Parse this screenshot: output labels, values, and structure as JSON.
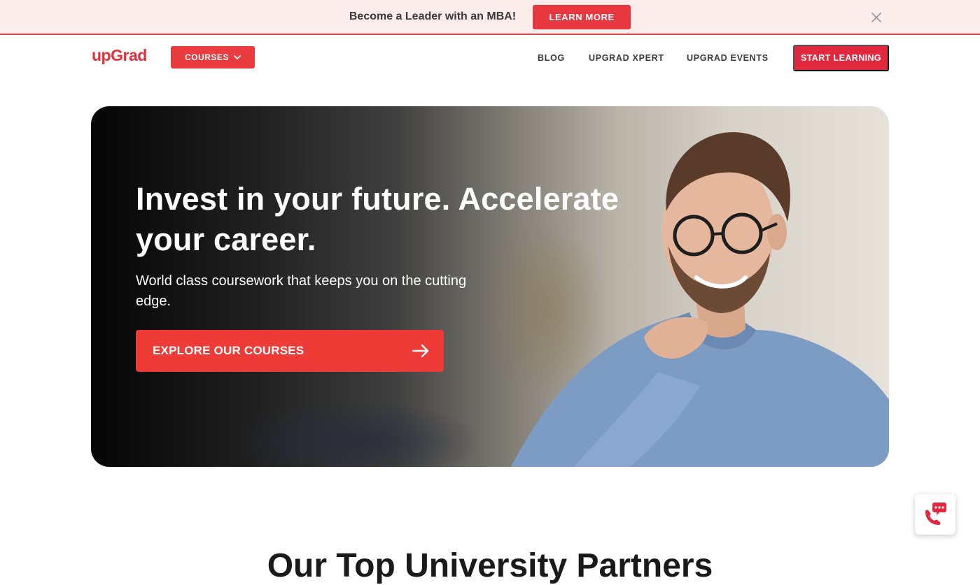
{
  "promo": {
    "text": "Become a Leader with an MBA!",
    "button_label": "LEARN MORE",
    "close_icon": "close-icon"
  },
  "nav": {
    "logo": "upGrad",
    "courses_label": "COURSES",
    "links": [
      "BLOG",
      "UPGRAD XPERT",
      "UPGRAD EVENTS"
    ],
    "cta_label": "START LEARNING"
  },
  "hero": {
    "title": "Invest in your future. Accelerate your career.",
    "subtitle": "World class coursework that keeps you on the cutting edge.",
    "cta_label": "EXPLORE OUR COURSES",
    "cta_icon": "arrow-right-icon"
  },
  "section": {
    "heading": "Our Top University Partners"
  },
  "widget": {
    "icon": "phone-chat-icon"
  },
  "colors": {
    "brand_red": "#e5303b",
    "button_red": "#ef3b36",
    "banner_bg": "#fdecec"
  }
}
